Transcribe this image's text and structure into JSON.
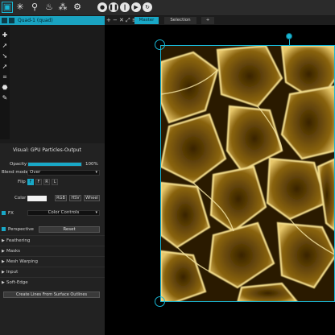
{
  "toolbar": {
    "icons": [
      "select-tool-icon",
      "particles-icon",
      "bulb-icon",
      "drop-icon",
      "nodes-icon",
      "settings-icon"
    ],
    "playback": [
      "pause-icon",
      "stop-icon",
      "play-icon",
      "reload-icon"
    ]
  },
  "layer": {
    "name": "Quad-1 (quad)"
  },
  "stage": {
    "tabs": [
      "Master",
      "Selection",
      "+"
    ],
    "controls": [
      "+",
      "−",
      "✕",
      "⤢",
      "≡"
    ]
  },
  "panel": {
    "title": "Visual: GPU Particles-Output",
    "opacity_label": "Opacity",
    "opacity_value": "100%",
    "opacity_fraction": 1.0,
    "blend_label": "Blend mode",
    "blend_value": "Over",
    "flip_label": "Flip",
    "flip_buttons": [
      "F",
      "F",
      "R",
      "L"
    ],
    "color_label": "Color",
    "color_buttons": [
      "RGB",
      "HSV",
      "Wheel"
    ],
    "fx_label": "FX",
    "fx_value": "Color Controls",
    "perspective_label": "Perspective",
    "reset_label": "Reset",
    "sections": [
      "Feathering",
      "Masks",
      "Mesh Warping",
      "Input",
      "Soft-Edge"
    ],
    "bottom_button": "Create Lines From Surface Outlines"
  },
  "colors": {
    "accent": "#19b6d4",
    "panel_bg": "#222222",
    "content_gold": "#e0c060"
  }
}
